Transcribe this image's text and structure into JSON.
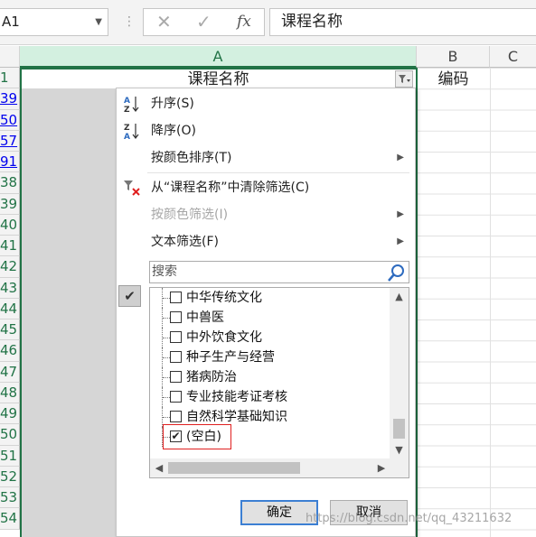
{
  "formula_bar": {
    "name_box": "A1",
    "cancel_icon": "✕",
    "enter_icon": "✓",
    "fx_icon": "fx",
    "formula": "课程名称"
  },
  "columns": [
    "A",
    "B",
    "C"
  ],
  "rows": [
    "1",
    "39",
    "50",
    "57",
    "91",
    "38",
    "39",
    "40",
    "41",
    "42",
    "43",
    "44",
    "45",
    "46",
    "47",
    "48",
    "49",
    "50",
    "51",
    "52",
    "53",
    "54"
  ],
  "cells": {
    "A1": "课程名称",
    "B1": "编码"
  },
  "filter_menu": {
    "sort_asc": "升序(S)",
    "sort_desc": "降序(O)",
    "sort_by_color": "按颜色排序(T)",
    "clear_filter": "从“课程名称”中清除筛选(C)",
    "filter_by_color": "按颜色筛选(I)",
    "text_filters": "文本筛选(F)",
    "search_placeholder": "搜索",
    "items": [
      {
        "label": "中华传统文化",
        "checked": false
      },
      {
        "label": "中兽医",
        "checked": false
      },
      {
        "label": "中外饮食文化",
        "checked": false
      },
      {
        "label": "种子生产与经营",
        "checked": false
      },
      {
        "label": "猪病防治",
        "checked": false
      },
      {
        "label": "专业技能考证考核",
        "checked": false
      },
      {
        "label": "自然科学基础知识",
        "checked": false
      },
      {
        "label": "(空白)",
        "checked": true
      }
    ],
    "ok": "确定",
    "cancel": "取消"
  },
  "watermark": "https://blog.csdn.net/qq_43211632",
  "colors": {
    "excel_green": "#217346",
    "highlight_red": "#e02020",
    "ok_border": "#3c7fd3"
  }
}
